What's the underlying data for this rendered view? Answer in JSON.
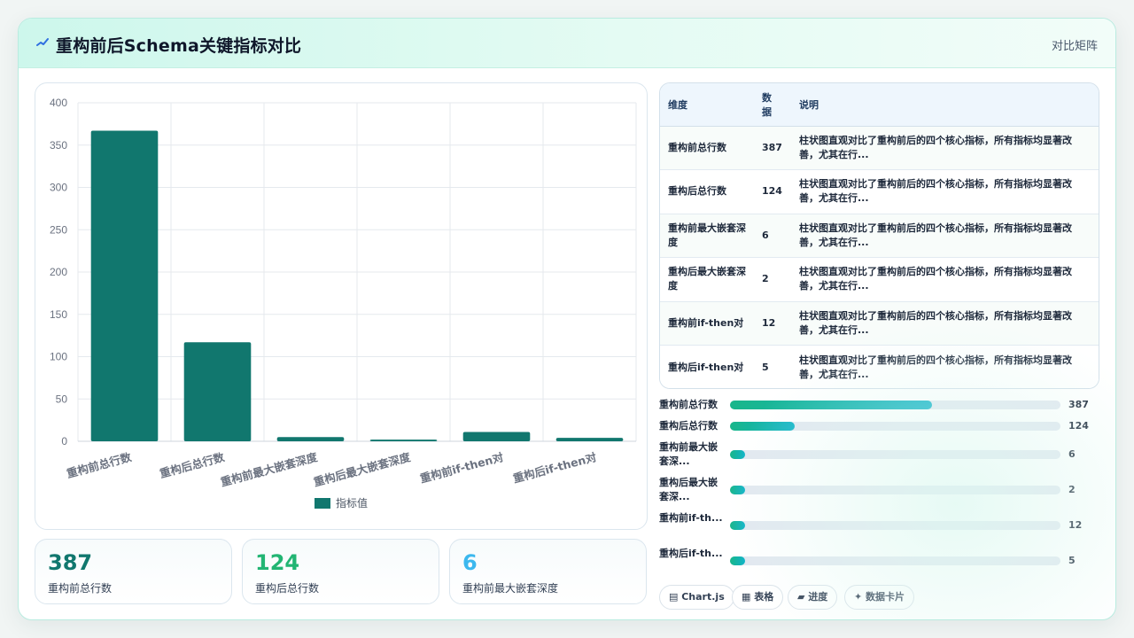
{
  "header": {
    "title": "重构前后Schema关键指标对比",
    "right_link": "对比矩阵",
    "logo_icon": "sparkline-icon"
  },
  "colors": {
    "bar": "#11776e",
    "accent_teal": "#1aa87f",
    "accent_green": "#22b573",
    "accent_blue": "#3cb8ee"
  },
  "chart_data": {
    "type": "bar",
    "categories": [
      "重构前总行数",
      "重构后总行数",
      "重构前最大嵌套深度",
      "重构后最大嵌套深度",
      "重构前if-then对",
      "重构后if-then对"
    ],
    "series": [
      {
        "name": "指标值",
        "values": [
          367,
          117,
          5,
          2,
          11,
          4
        ]
      }
    ],
    "yticks": [
      "0",
      "50",
      "100",
      "150",
      "200",
      "250",
      "300",
      "350",
      "400"
    ],
    "ylim": [
      0,
      400
    ],
    "grid": true,
    "legend_position": "bottom"
  },
  "stats": [
    {
      "value": "387",
      "label": "重构前总行数",
      "color": "#11776e"
    },
    {
      "value": "124",
      "label": "重构后总行数",
      "color": "#22b573"
    },
    {
      "value": "6",
      "label": "重构前最大嵌套深度",
      "color": "#3cb8ee"
    }
  ],
  "table": {
    "headers": [
      "维度",
      "数据",
      "说明"
    ],
    "rows": [
      {
        "dim": "重构前总行数",
        "val": "387",
        "desc": "柱状图直观对比了重构前后的四个核心指标，所有指标均显著改善，尤其在行..."
      },
      {
        "dim": "重构后总行数",
        "val": "124",
        "desc": "柱状图直观对比了重构前后的四个核心指标，所有指标均显著改善，尤其在行..."
      },
      {
        "dim": "重构前最大嵌套深度",
        "val": "6",
        "desc": "柱状图直观对比了重构前后的四个核心指标，所有指标均显著改善，尤其在行..."
      },
      {
        "dim": "重构后最大嵌套深度",
        "val": "2",
        "desc": "柱状图直观对比了重构前后的四个核心指标，所有指标均显著改善，尤其在行..."
      },
      {
        "dim": "重构前if-then对",
        "val": "12",
        "desc": "柱状图直观对比了重构前后的四个核心指标，所有指标均显著改善，尤其在行..."
      },
      {
        "dim": "重构后if-then对",
        "val": "5",
        "desc": "柱状图直观对比了重构前后的四个核心指标，所有指标均显著改善，尤其在行..."
      }
    ]
  },
  "progress": [
    {
      "label": "重构前总行数",
      "value": "387",
      "fraction": 0.61
    },
    {
      "label": "重构后总行数",
      "value": "124",
      "fraction": 0.196
    },
    {
      "label": "重构前最大嵌套深...",
      "value": "6",
      "fraction": 0.0095
    },
    {
      "label": "重构后最大嵌套深...",
      "value": "2",
      "fraction": 0.003
    },
    {
      "label": "重构前if-th...",
      "value": "12",
      "fraction": 0.019
    },
    {
      "label": "重构后if-th...",
      "value": "5",
      "fraction": 0.008
    }
  ],
  "chips": [
    {
      "label": "Chart.js",
      "icon": "chart-icon"
    },
    {
      "label": "表格",
      "icon": "table-icon"
    },
    {
      "label": "进度",
      "icon": "progress-icon"
    },
    {
      "label": "数据卡片",
      "icon": "sparkle-icon"
    }
  ]
}
